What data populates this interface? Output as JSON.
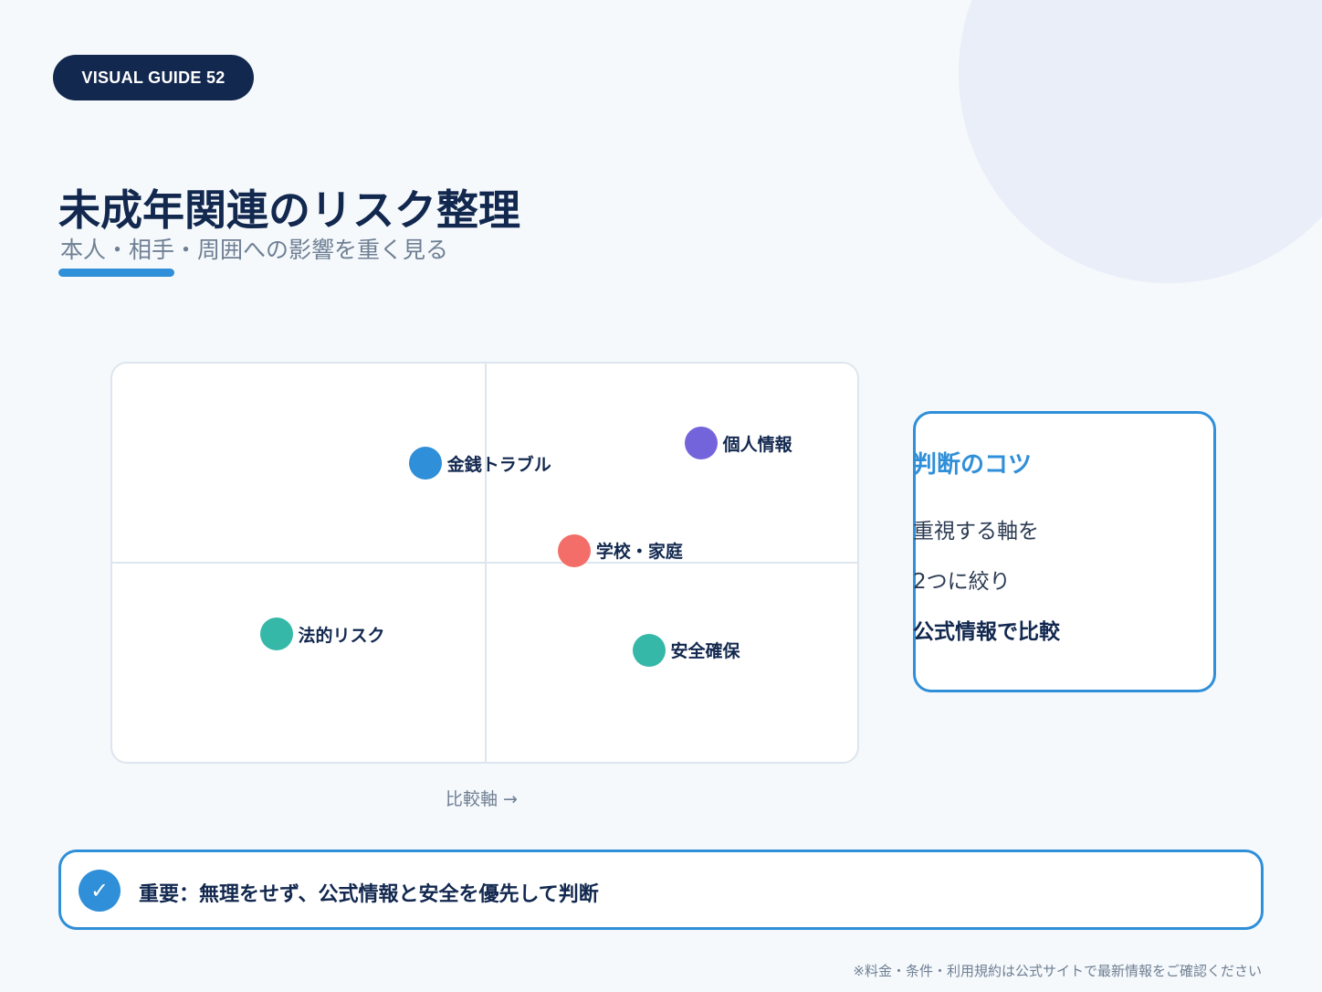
{
  "badge": {
    "label": "VISUAL GUIDE 52"
  },
  "header": {
    "title": "未成年関連のリスク整理",
    "subtitle": "本人・相手・周囲への影響を重く見る"
  },
  "matrix": {
    "x_axis_label": "比較軸 →",
    "points": [
      {
        "label": "金銭トラブル",
        "x": 0.42,
        "y": 0.75,
        "color": "#2f8fd8"
      },
      {
        "label": "個人情報",
        "x": 0.79,
        "y": 0.8,
        "color": "#7464dc"
      },
      {
        "label": "学校・家庭",
        "x": 0.62,
        "y": 0.53,
        "color": "#f36e68"
      },
      {
        "label": "法的リスク",
        "x": 0.22,
        "y": 0.32,
        "color": "#35b8a8"
      },
      {
        "label": "安全確保",
        "x": 0.72,
        "y": 0.28,
        "color": "#35b8a8"
      }
    ]
  },
  "tips": {
    "title": "判断のコツ",
    "line1": "重視する軸を",
    "line2": "2つに絞り",
    "line3": "公式情報で比較"
  },
  "note": {
    "icon": "check-icon",
    "text": "重要：無理をせず、公式情報と安全を優先して判断"
  },
  "footnote": "※料金・条件・利用規約は公式サイトで最新情報をご確認ください",
  "colors": {
    "navy": "#12284f",
    "accent": "#2f8fd8",
    "background": "#f5f9fc"
  }
}
